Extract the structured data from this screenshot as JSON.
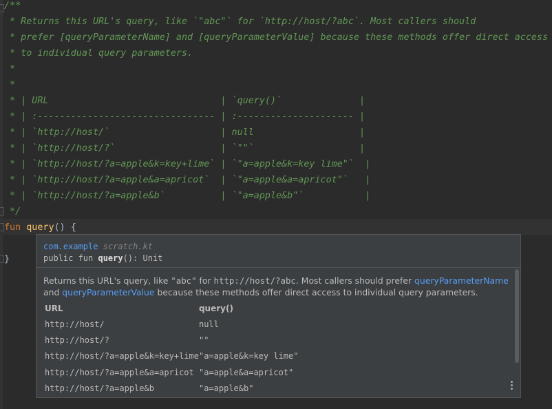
{
  "comment_lines": [
    "/**",
    " * Returns this URL's query, like `\"abc\"` for `http://host/?abc`. Most callers should",
    " * prefer [queryParameterName] and [queryParameterValue] because these methods offer direct access",
    " * to individual query parameters.",
    " *",
    " *",
    " * | URL                               | `query()`              |",
    " * | :-------------------------------- | :--------------------- |",
    " * | `http://host/`                    | null                   |",
    " * | `http://host/?`                   | `\"\"`                   |",
    " * | `http://host/?a=apple&k=key+lime` | `\"a=apple&k=key lime\"`  |",
    " * | `http://host/?a=apple&a=apricot`  | `\"a=apple&a=apricot\"`   |",
    " * | `http://host/?a=apple&b`          | `\"a=apple&b\"`           |",
    " */"
  ],
  "code": {
    "keyword": "fun",
    "name": "query",
    "rest": "() {",
    "closing": "}"
  },
  "popup": {
    "package": "com.example",
    "file": "scratch.kt",
    "signature_prefix": "public fun ",
    "signature_name": "query",
    "signature_suffix": "(): Unit",
    "desc1": "Returns this URL's query, like ",
    "desc_code1": "\"abc\"",
    "desc2": " for ",
    "desc_code2": "http://host/?abc",
    "desc3": ". Most callers should prefer ",
    "link1": "queryParameterName",
    "desc4": "and ",
    "link2": "queryParameterValue",
    "desc5": " because these methods offer direct access to individual query parameters.",
    "table": {
      "headers": [
        "URL",
        "query()"
      ],
      "rows": [
        [
          "http://host/",
          "null"
        ],
        [
          "http://host/?",
          "\"\""
        ],
        [
          "http://host/?a=apple&k=key+lime",
          "\"a=apple&k=key lime\""
        ],
        [
          "http://host/?a=apple&a=apricot",
          "\"a=apple&a=apricot\""
        ],
        [
          "http://host/?a=apple&b",
          "\"a=apple&b\""
        ]
      ]
    }
  }
}
